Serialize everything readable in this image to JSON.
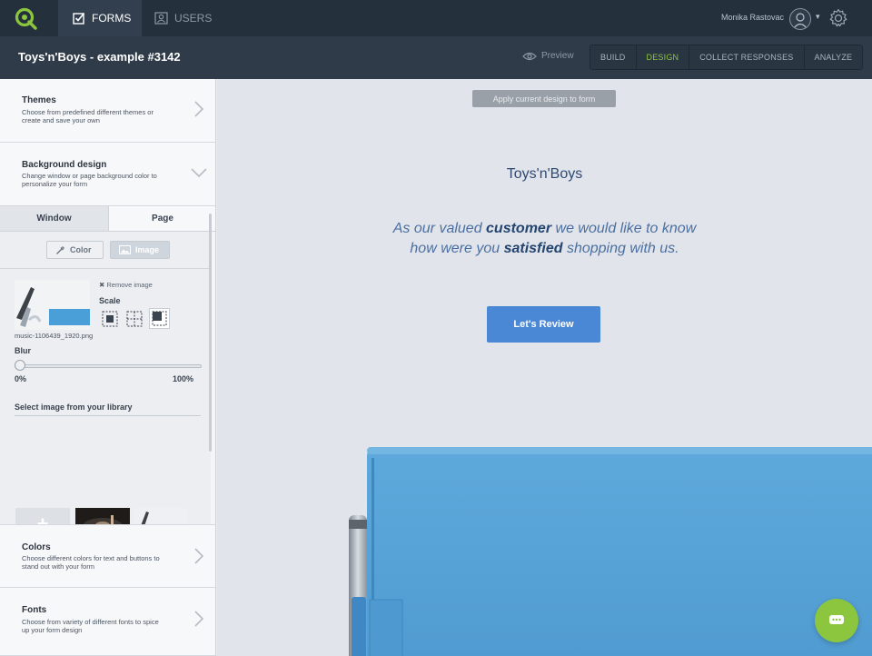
{
  "nav": {
    "tabs": [
      {
        "label": "FORMS",
        "icon": "checkbox-icon"
      },
      {
        "label": "USERS",
        "icon": "user-card-icon"
      }
    ],
    "user_name": "Monika Rastovac"
  },
  "form": {
    "title": "Toys'n'Boys - example #3142",
    "preview_label": "Preview",
    "modes": [
      "BUILD",
      "DESIGN",
      "COLLECT RESPONSES",
      "ANALYZE"
    ],
    "active_mode": "DESIGN"
  },
  "sidebar": {
    "themes": {
      "title": "Themes",
      "desc": "Choose from predefined different themes or create and save your own"
    },
    "background": {
      "title": "Background design",
      "desc": "Change window or page background color to personalize your form"
    },
    "tabs": [
      "Window",
      "Page"
    ],
    "toggles": {
      "color": "Color",
      "image": "Image"
    },
    "remove_image": "Remove image",
    "scale_label": "Scale",
    "file_name": "music-1106439_1920.png",
    "blur": {
      "label": "Blur",
      "min": "0%",
      "max": "100%",
      "value": 0
    },
    "library_label": "Select image from your library",
    "colors": {
      "title": "Colors",
      "desc": "Choose different colors for text and buttons to stand out with your form"
    },
    "fonts": {
      "title": "Fonts",
      "desc": "Choose from variety of different fonts to spice up your form design"
    }
  },
  "canvas": {
    "apply_label": "Apply current design to form",
    "brand": "Toys'n'Boys",
    "intro_1a": "As our valued ",
    "intro_1b": "customer",
    "intro_1c": " we would like to know",
    "intro_2a": "how were you ",
    "intro_2b": "satisfied",
    "intro_2c": " shopping with us.",
    "cta_label": "Let's Review"
  },
  "colors": {
    "accent": "#8cc63f",
    "topbar": "#25303d",
    "cta": "#4a87d5"
  }
}
